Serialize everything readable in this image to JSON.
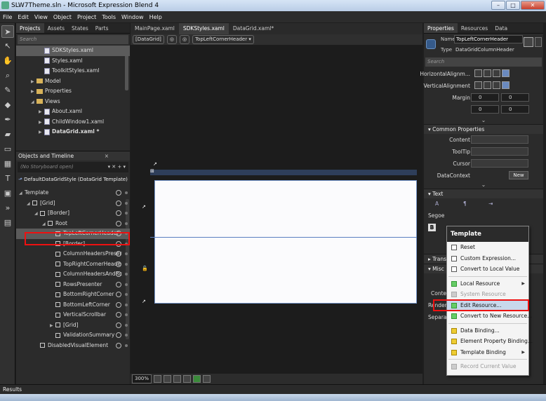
{
  "window": {
    "title": "SLW7Theme.sln - Microsoft Expression Blend 4"
  },
  "menu": [
    "File",
    "Edit",
    "View",
    "Object",
    "Project",
    "Tools",
    "Window",
    "Help"
  ],
  "left_tabs": [
    "Projects",
    "Assets",
    "States",
    "Parts"
  ],
  "search_placeholder": "Search",
  "project_tree": [
    {
      "label": "SDKStyles.xaml",
      "kind": "file",
      "indent": 2,
      "selected": true
    },
    {
      "label": "Styles.xaml",
      "kind": "file",
      "indent": 2
    },
    {
      "label": "ToolkitStyles.xaml",
      "kind": "file",
      "indent": 2
    },
    {
      "label": "Model",
      "kind": "folder",
      "indent": 1,
      "arrow": "▶"
    },
    {
      "label": "Properties",
      "kind": "folder",
      "indent": 1,
      "arrow": "▶"
    },
    {
      "label": "Views",
      "kind": "folder",
      "indent": 1,
      "arrow": "◢"
    },
    {
      "label": "About.xaml",
      "kind": "file",
      "indent": 2,
      "arrow": "▶"
    },
    {
      "label": "ChildWindow1.xaml",
      "kind": "file",
      "indent": 2,
      "arrow": "▶"
    },
    {
      "label": "DataGrid.xaml *",
      "kind": "file",
      "indent": 2,
      "arrow": "▶",
      "bold": true
    }
  ],
  "objects_timeline": {
    "header": "Objects and Timeline",
    "storyboard": "(No Storyboard open)",
    "scope": "DefaultDataGridStyle (DataGrid Template)"
  },
  "element_tree": [
    {
      "label": "Template",
      "indent": 0,
      "arrow": "◢"
    },
    {
      "label": "[Grid]",
      "indent": 1,
      "arrow": "◢"
    },
    {
      "label": "[Border]",
      "indent": 2,
      "arrow": "◢"
    },
    {
      "label": "Root",
      "indent": 3,
      "arrow": "◢"
    },
    {
      "label": "TopLeftCornerHeader",
      "indent": 4,
      "selected": true
    },
    {
      "label": "[Border]",
      "indent": 4
    },
    {
      "label": "ColumnHeadersPreser",
      "indent": 4
    },
    {
      "label": "TopRightCornerHeade",
      "indent": 4
    },
    {
      "label": "ColumnHeadersAndRc",
      "indent": 4
    },
    {
      "label": "RowsPresenter",
      "indent": 4
    },
    {
      "label": "BottomRightCorner",
      "indent": 4
    },
    {
      "label": "BottomLeftCorner",
      "indent": 4
    },
    {
      "label": "VerticalScrollbar",
      "indent": 4
    },
    {
      "label": "[Grid]",
      "indent": 4,
      "arrow": "▶"
    },
    {
      "label": "ValidationSummary",
      "indent": 4
    },
    {
      "label": "DisabledVisualElement",
      "indent": 2
    }
  ],
  "doc_tabs": [
    "MainPage.xaml",
    "SDKStyles.xaml",
    "DataGrid.xaml*"
  ],
  "breadcrumb": {
    "root": "[DataGrid]",
    "element": "TopLeftCornerHeader ▾"
  },
  "zoom": "300%",
  "right_tabs": [
    "Properties",
    "Resources",
    "Data"
  ],
  "properties": {
    "name_label": "Name",
    "name_value": "TopLeftCornerHeader",
    "type_label": "Type",
    "type_value": "DataGridColumnHeader",
    "horizontal_alignment": "HorizontalAlignm...",
    "vertical_alignment": "VerticalAlignment",
    "margin_label": "Margin",
    "margins": [
      "0",
      "0",
      "0",
      "0"
    ]
  },
  "common": {
    "header": "Common Properties",
    "labels": [
      "Content",
      "ToolTip",
      "Cursor",
      "DataContext"
    ],
    "new_label": "New"
  },
  "text_section": {
    "header": "Text",
    "font": "Segoe",
    "bold": "B"
  },
  "partial_labels": [
    "Trans",
    "Misc",
    "Conte",
    "Render",
    "Separa"
  ],
  "context_menu": {
    "title": "Template",
    "items": [
      {
        "label": "Reset",
        "icon": "white"
      },
      {
        "label": "Custom Expression...",
        "icon": "white"
      },
      {
        "label": "Convert to Local Value",
        "icon": "white",
        "sep": true
      },
      {
        "label": "Local Resource",
        "icon": "green",
        "submenu": true
      },
      {
        "label": "System Resource",
        "icon": "grey",
        "disabled": true
      },
      {
        "label": "Edit Resource...",
        "icon": "green",
        "highlight": true
      },
      {
        "label": "Convert to New Resource...",
        "icon": "green",
        "sep": true
      },
      {
        "label": "Data Binding...",
        "icon": "yellow"
      },
      {
        "label": "Element Property Binding...",
        "icon": "yellow"
      },
      {
        "label": "Template Binding",
        "icon": "yellow",
        "submenu": true,
        "sep": true
      },
      {
        "label": "Record Current Value",
        "icon": "grey",
        "disabled": true
      }
    ]
  },
  "status": {
    "results": "Results"
  }
}
